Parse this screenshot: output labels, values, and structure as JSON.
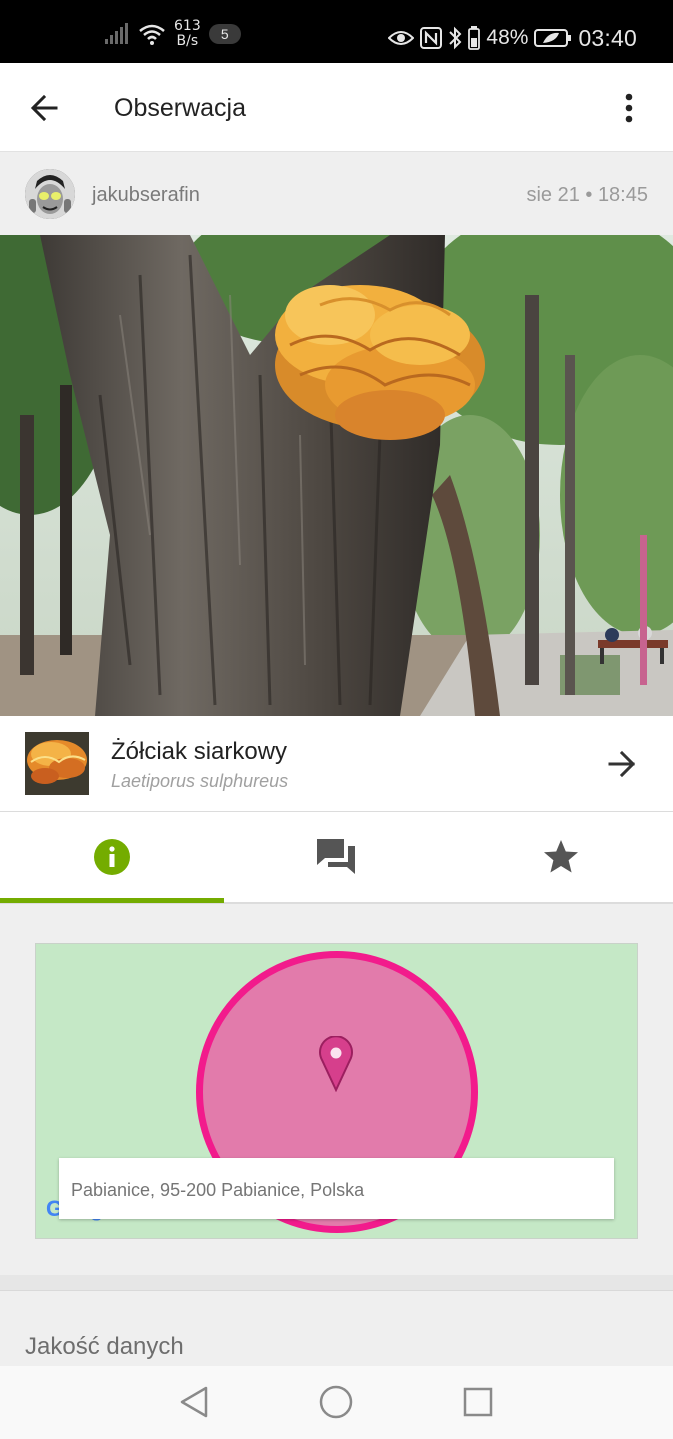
{
  "status_bar": {
    "net_speed_value": "613",
    "net_speed_unit": "B/s",
    "notification_count": "5",
    "battery": "48%",
    "time": "03:40"
  },
  "app_bar": {
    "title": "Obserwacja"
  },
  "observation": {
    "username": "jakubserafin",
    "date": "sie 21 • 18:45"
  },
  "taxon": {
    "common_name": "Żółciak siarkowy",
    "scientific_name": "Laetiporus sulphureus"
  },
  "tabs": [
    {
      "name": "info-icon",
      "active": true
    },
    {
      "name": "chat-icon",
      "active": false
    },
    {
      "name": "star-icon",
      "active": false
    }
  ],
  "map": {
    "address": "Pabianice, 95-200 Pabianice, Polska",
    "attribution": "Google"
  },
  "section": {
    "title": "Jakość danych"
  },
  "colors": {
    "accent": "#74ac00",
    "map_bg": "#c5e8c6",
    "accuracy_fill": "#e27bab",
    "accuracy_stroke": "#f21b8c"
  }
}
